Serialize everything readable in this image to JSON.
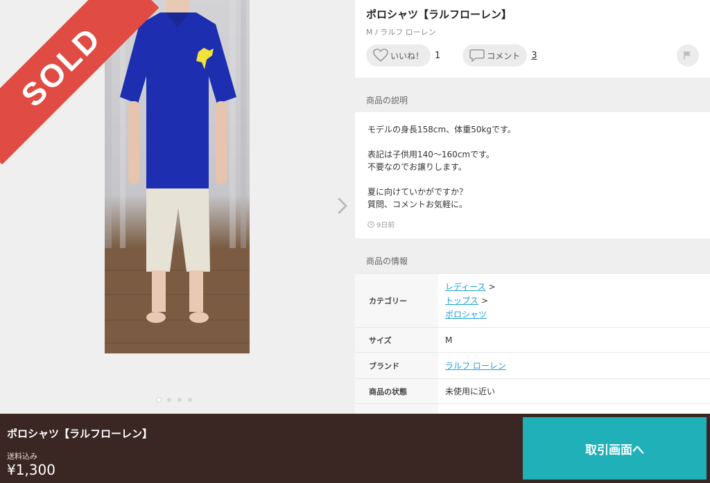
{
  "photo": {
    "sold_label": "SOLD",
    "page_dots": 4,
    "active_dot": 0
  },
  "item": {
    "title": "ポロシャツ【ラルフローレン】",
    "subtitle": "M / ラルフ ローレン"
  },
  "actions": {
    "like_label": "いいね！",
    "like_count": "1",
    "comment_label": "コメント",
    "comment_count": "3"
  },
  "description": {
    "header": "商品の説明",
    "lines": [
      "モデルの身長158cm、体重50kgです。",
      "",
      "表記は子供用140〜160cmです。",
      "不要なのでお譲りします。",
      "",
      "夏に向けていかがですか？",
      "質問、コメントお気軽に。"
    ],
    "posted": "9日前"
  },
  "info": {
    "header": "商品の情報",
    "category": {
      "label": "カテゴリー",
      "items": [
        "レディース",
        "トップス",
        "ポロシャツ"
      ],
      "separator": ">"
    },
    "size": {
      "label": "サイズ",
      "value": "M"
    },
    "brand": {
      "label": "ブランド",
      "value": "ラルフ ローレン"
    },
    "condition": {
      "label": "商品の状態",
      "value": "未使用に近い"
    }
  },
  "bottom_bar": {
    "title": "ポロシャツ【ラルフローレン】",
    "shipping": "送料込み",
    "price": "¥1,300",
    "cta_label": "取引画面へ"
  },
  "colors": {
    "sold_ribbon": "#e04b43",
    "cta": "#1fb0b8",
    "bottom_bar": "#3a2723",
    "link": "#1a9fd6"
  }
}
